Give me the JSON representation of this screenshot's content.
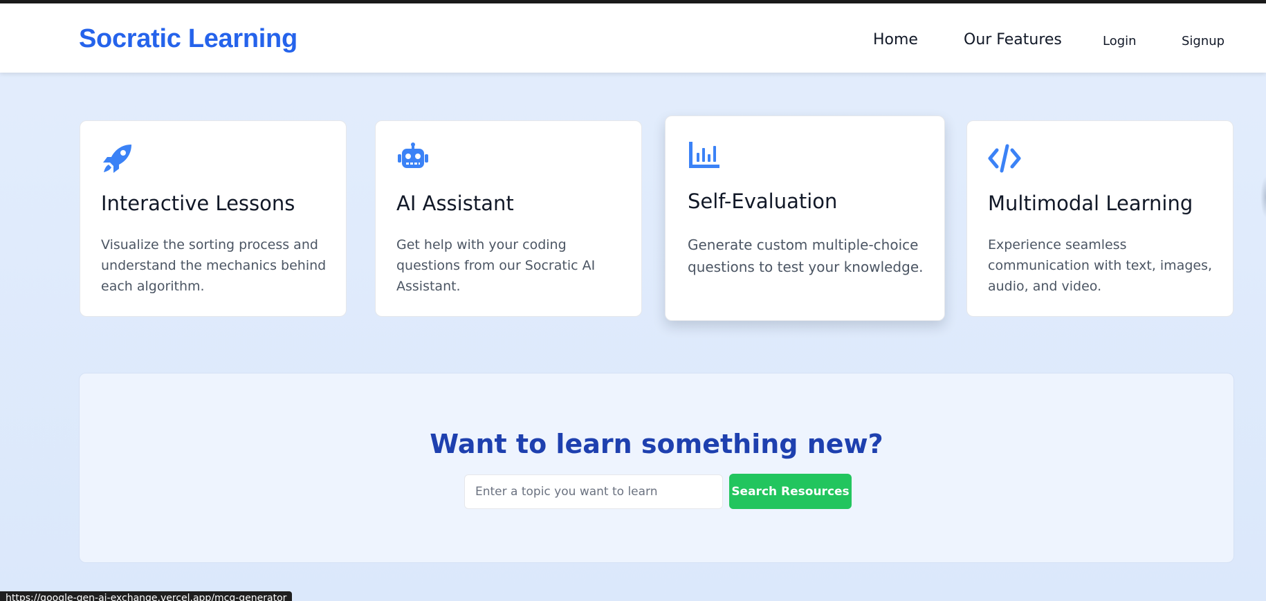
{
  "brand": "Socratic Learning",
  "nav": {
    "home": "Home",
    "features": "Our Features",
    "login": "Login",
    "signup": "Signup"
  },
  "cards": [
    {
      "icon": "rocket-icon",
      "title": "Interactive Lessons",
      "description": "Visualize the sorting process and understand the mechanics behind each algorithm."
    },
    {
      "icon": "robot-icon",
      "title": "AI Assistant",
      "description": "Get help with your coding questions from our Socratic AI Assistant."
    },
    {
      "icon": "bar-chart-icon",
      "title": "Self-Evaluation",
      "description": "Generate custom multiple-choice questions to test your knowledge."
    },
    {
      "icon": "code-icon",
      "title": "Multimodal Learning",
      "description": "Experience seamless communication with text, images, audio, and video."
    }
  ],
  "hero": {
    "title": "Want to learn something new?",
    "search_placeholder": "Enter a topic you want to learn",
    "search_value": "",
    "button_label": "Search Resources"
  },
  "status_bar": {
    "url": "https://google-gen-ai-exchange.vercel.app/mcq-generator"
  },
  "colors": {
    "brand": "#2563eb",
    "icon": "#3b82f6",
    "hero_title": "#1e40af",
    "button": "#22c55e"
  }
}
